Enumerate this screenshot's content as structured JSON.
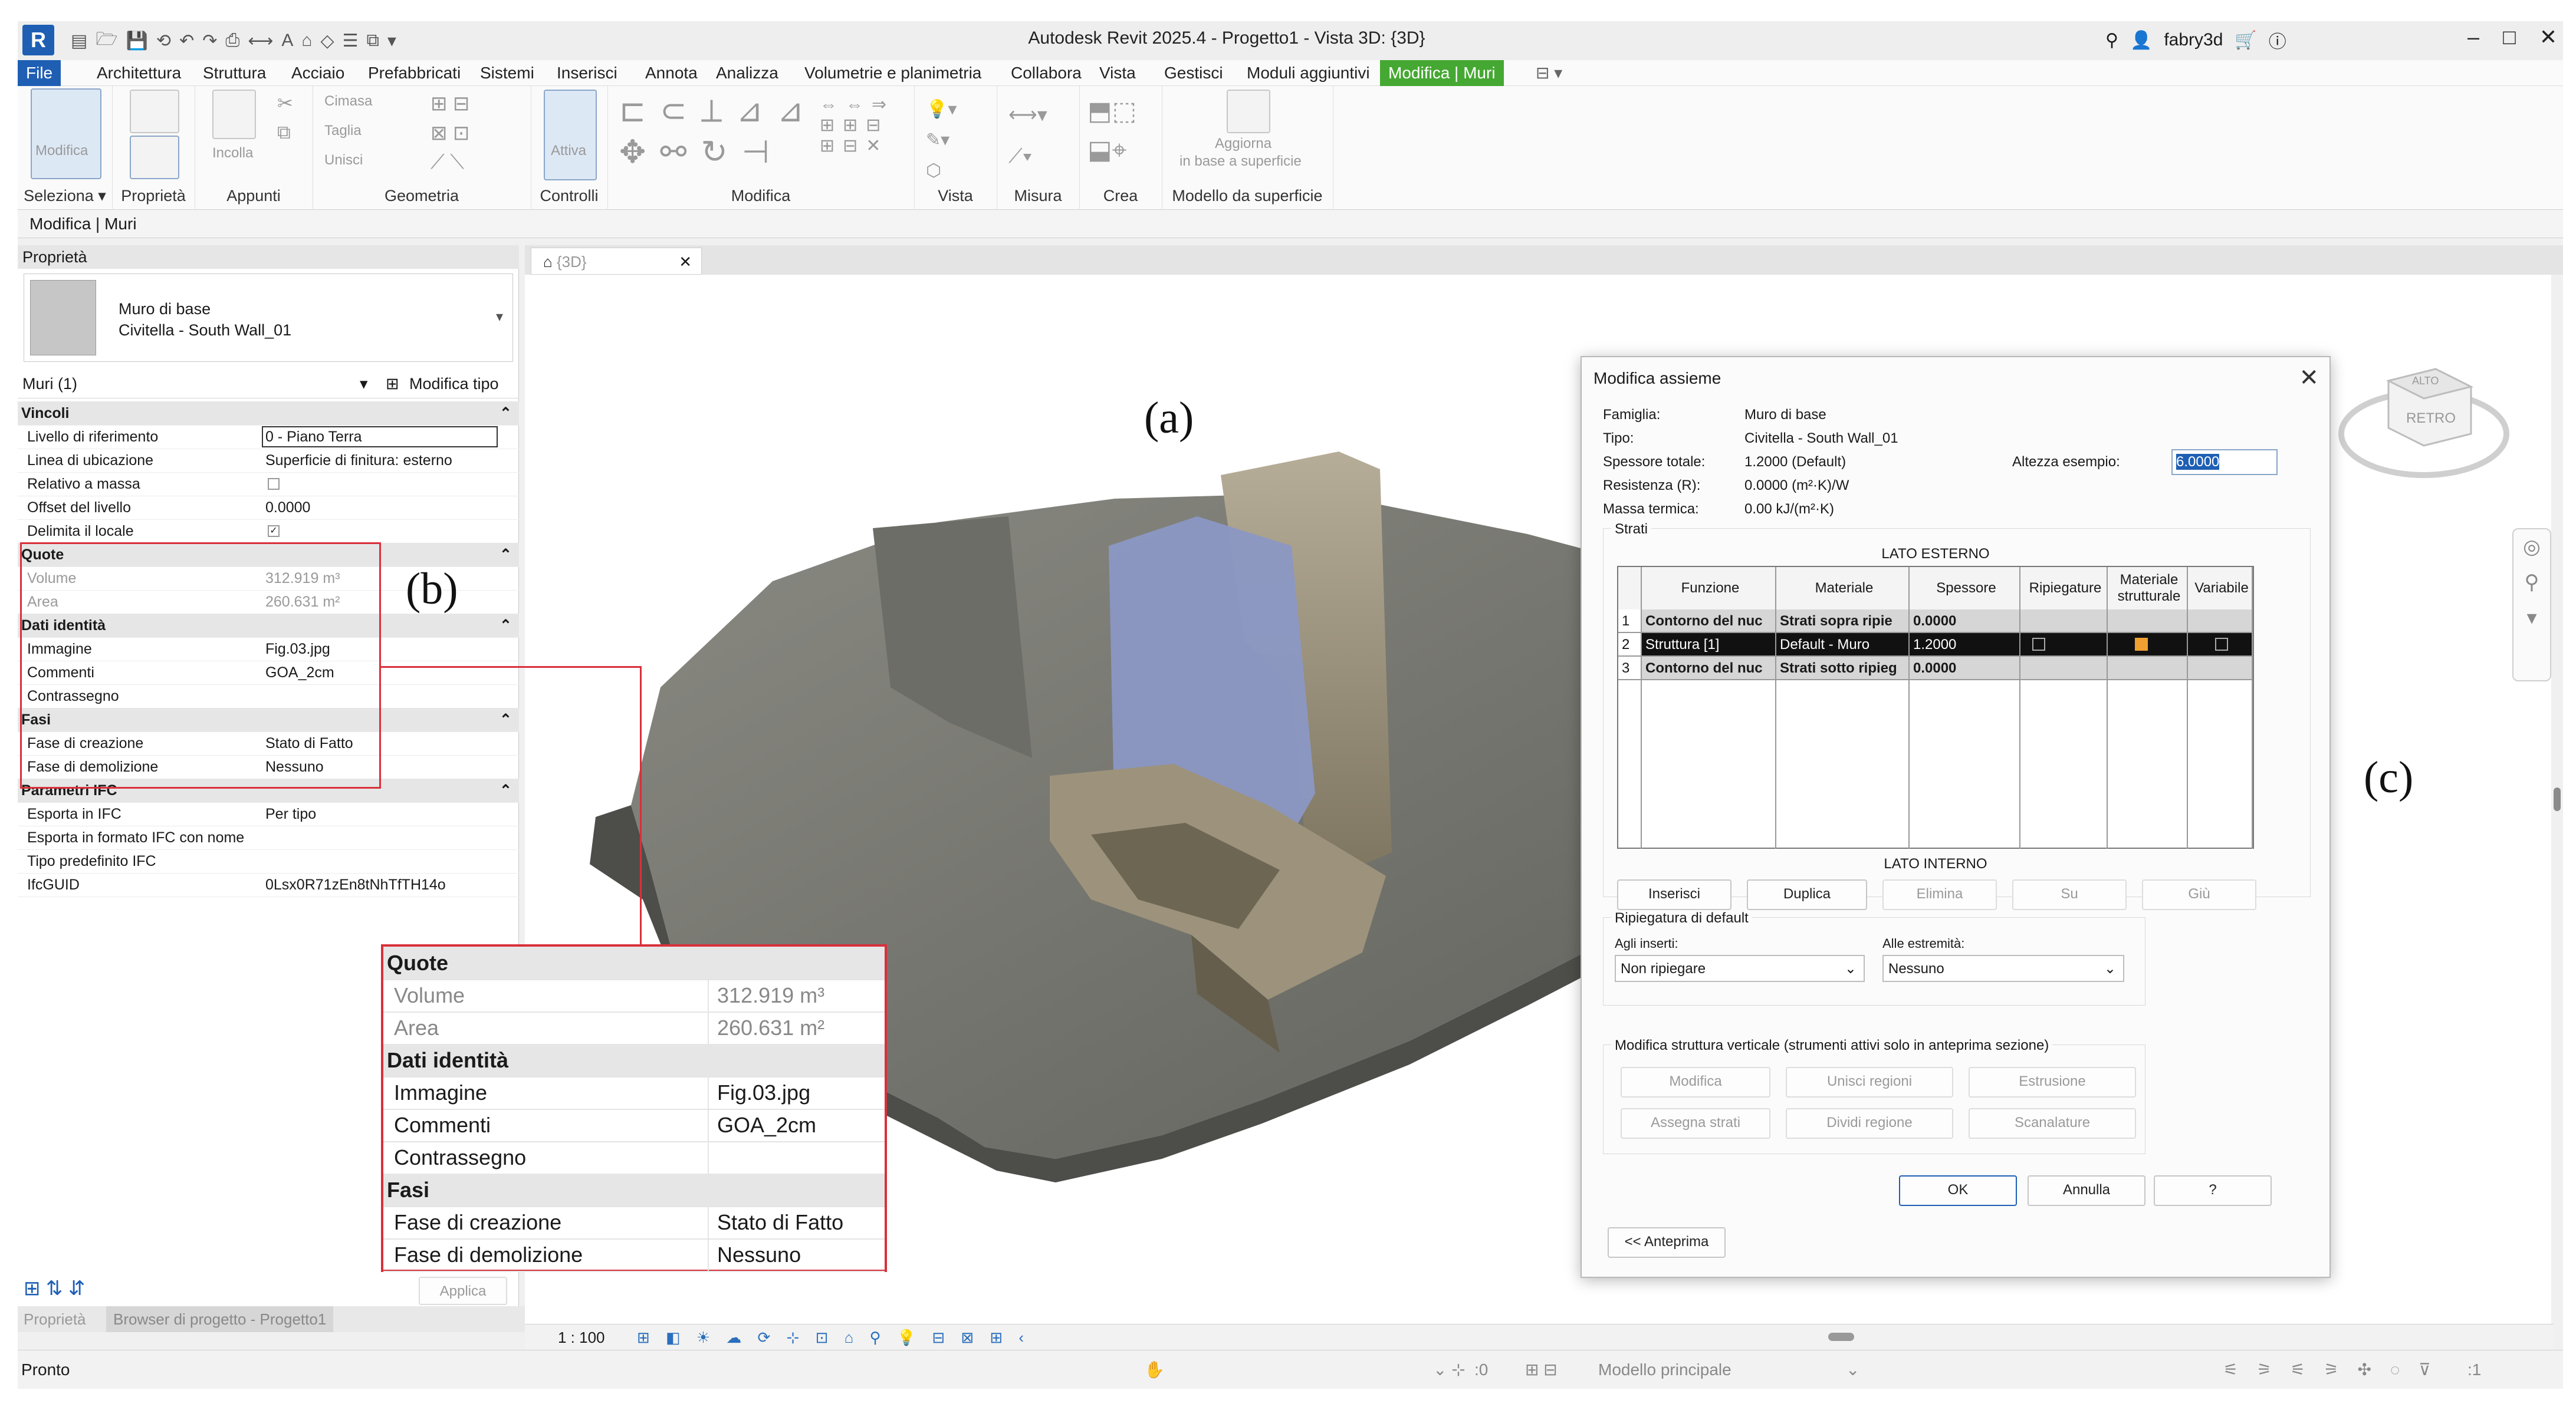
{
  "app": {
    "logo": "R",
    "title": "Autodesk Revit 2025.4 - Progetto1 - Vista 3D: {3D}",
    "user": "fabry3d",
    "win_min": "–",
    "win_max": "□",
    "win_close": "✕"
  },
  "menu": [
    "File",
    "Architettura",
    "Struttura",
    "Acciaio",
    "Prefabbricati",
    "Sistemi",
    "Inserisci",
    "Annota",
    "Analizza",
    "Volumetrie e planimetria",
    "Collabora",
    "Vista",
    "Gestisci",
    "Moduli aggiuntivi",
    "Modifica | Muri"
  ],
  "ribbon": {
    "panels": [
      "Seleziona ▾",
      "Proprietà",
      "Appunti",
      "Geometria",
      "Controlli",
      "Modifica",
      "Vista",
      "Misura",
      "Crea",
      "Modello da superficie"
    ],
    "modifica_btn": "Modifica",
    "incolla": "Incolla",
    "cimasa": "Cimasa",
    "taglia": "Taglia",
    "unisci": "Unisci",
    "attiva": "Attiva",
    "aggiorna": "Aggiorna",
    "in_base": "in base a superficie"
  },
  "option_bar": "Modifica | Muri",
  "properties": {
    "header": "Proprietà",
    "family": "Muro di base",
    "type": "Civitella - South Wall_01",
    "instance": "Muri (1)",
    "edit_type": "Modifica tipo",
    "rows": [
      {
        "k": "Vincoli",
        "grp": true
      },
      {
        "k": "Livello di riferimento",
        "v": "0 - Piano Terra"
      },
      {
        "k": "Linea di ubicazione",
        "v": "Superficie di finitura: esterno"
      },
      {
        "k": "Relativo a massa",
        "v": ""
      },
      {
        "k": "Offset del livello",
        "v": "0.0000"
      },
      {
        "k": "Delimita il locale",
        "v": ""
      },
      {
        "k": "Quote",
        "grp": true
      },
      {
        "k": "Volume",
        "v": "312.919 m³",
        "dim": true
      },
      {
        "k": "Area",
        "v": "260.631 m²",
        "dim": true
      },
      {
        "k": "Dati identità",
        "grp": true
      },
      {
        "k": "Immagine",
        "v": "Fig.03.jpg"
      },
      {
        "k": "Commenti",
        "v": "GOA_2cm"
      },
      {
        "k": "Contrassegno",
        "v": ""
      },
      {
        "k": "Fasi",
        "grp": true
      },
      {
        "k": "Fase di creazione",
        "v": "Stato di Fatto"
      },
      {
        "k": "Fase di demolizione",
        "v": "Nessuno"
      },
      {
        "k": "Parametri IFC",
        "grp": true
      },
      {
        "k": "Esporta in IFC",
        "v": "Per tipo"
      },
      {
        "k": "Esporta in formato IFC con nome",
        "v": ""
      },
      {
        "k": "Tipo predefinito IFC",
        "v": ""
      },
      {
        "k": "IfcGUID",
        "v": "0Lsx0R71zEn8tNhTfTH14o"
      }
    ],
    "apply": "Applica",
    "tab_props": "Proprietà",
    "tab_browser": "Browser di progetto - Progetto1"
  },
  "zoom_panel": {
    "rows": [
      {
        "k": "Quote",
        "grp": true
      },
      {
        "k": "Volume",
        "v": "312.919 m³",
        "dim": true
      },
      {
        "k": "Area",
        "v": "260.631 m²",
        "dim": true
      },
      {
        "k": "Dati identità",
        "grp": true
      },
      {
        "k": "Immagine",
        "v": "Fig.03.jpg"
      },
      {
        "k": "Commenti",
        "v": "GOA_2cm"
      },
      {
        "k": "Contrassegno",
        "v": ""
      },
      {
        "k": "Fasi",
        "grp": true
      },
      {
        "k": "Fase di creazione",
        "v": "Stato di Fatto"
      },
      {
        "k": "Fase di demolizione",
        "v": "Nessuno"
      }
    ]
  },
  "view": {
    "tab": "{3D}",
    "scale": "1 : 100",
    "viewcube": "RETRO",
    "viewcube_top": "ALTO"
  },
  "labels": {
    "a": "(a)",
    "b": "(b)",
    "c": "(c)"
  },
  "dialog": {
    "title": "Modifica assieme",
    "info": [
      {
        "k": "Famiglia:",
        "v": "Muro di base"
      },
      {
        "k": "Tipo:",
        "v": "Civitella - South Wall_01"
      },
      {
        "k": "Spessore totale:",
        "v": "1.2000 (Default)"
      },
      {
        "k": "Resistenza (R):",
        "v": "0.0000 (m²·K)/W"
      },
      {
        "k": "Massa termica:",
        "v": "0.00 kJ/(m²·K)"
      }
    ],
    "altezza_label": "Altezza esempio:",
    "altezza_value": "6.0000",
    "strati": "Strati",
    "lato_esterno": "LATO ESTERNO",
    "lato_interno": "LATO INTERNO",
    "columns": [
      "Funzione",
      "Materiale",
      "Spessore",
      "Ripiegature",
      "Materiale strutturale",
      "Variabile"
    ],
    "layers": [
      {
        "n": "1",
        "funzione": "Contorno del nuc",
        "materiale": "Strati sopra ripie",
        "spessore": "0.0000"
      },
      {
        "n": "2",
        "funzione": "Struttura [1]",
        "materiale": "Default - Muro",
        "spessore": "1.2000"
      },
      {
        "n": "3",
        "funzione": "Contorno del nuc",
        "materiale": "Strati sotto ripieg",
        "spessore": "0.0000"
      }
    ],
    "layer_buttons": [
      "Inserisci",
      "Duplica",
      "Elimina",
      "Su",
      "Giù"
    ],
    "ripiegatura": "Ripiegatura di default",
    "agli_inserti": "Agli inserti:",
    "agli_inserti_val": "Non ripiegare",
    "alle_estremita": "Alle estremità:",
    "alle_estremita_val": "Nessuno",
    "struttura_verticale": "Modifica struttura verticale (strumenti attivi solo in anteprima sezione)",
    "vert_buttons": [
      "Modifica",
      "Unisci regioni",
      "Estrusione",
      "Assegna strati",
      "Dividi regione",
      "Scanalature"
    ],
    "ok": "OK",
    "annulla": "Annulla",
    "help": "?",
    "anteprima": "<< Anteprima"
  },
  "status": {
    "left": "Pronto",
    "model": "Modello principale",
    "filter": ":0",
    "filter2": ":1"
  },
  "colors": {
    "accent": "#1e5fb4",
    "contextual": "#45a832",
    "annotation": "#d9303b"
  }
}
